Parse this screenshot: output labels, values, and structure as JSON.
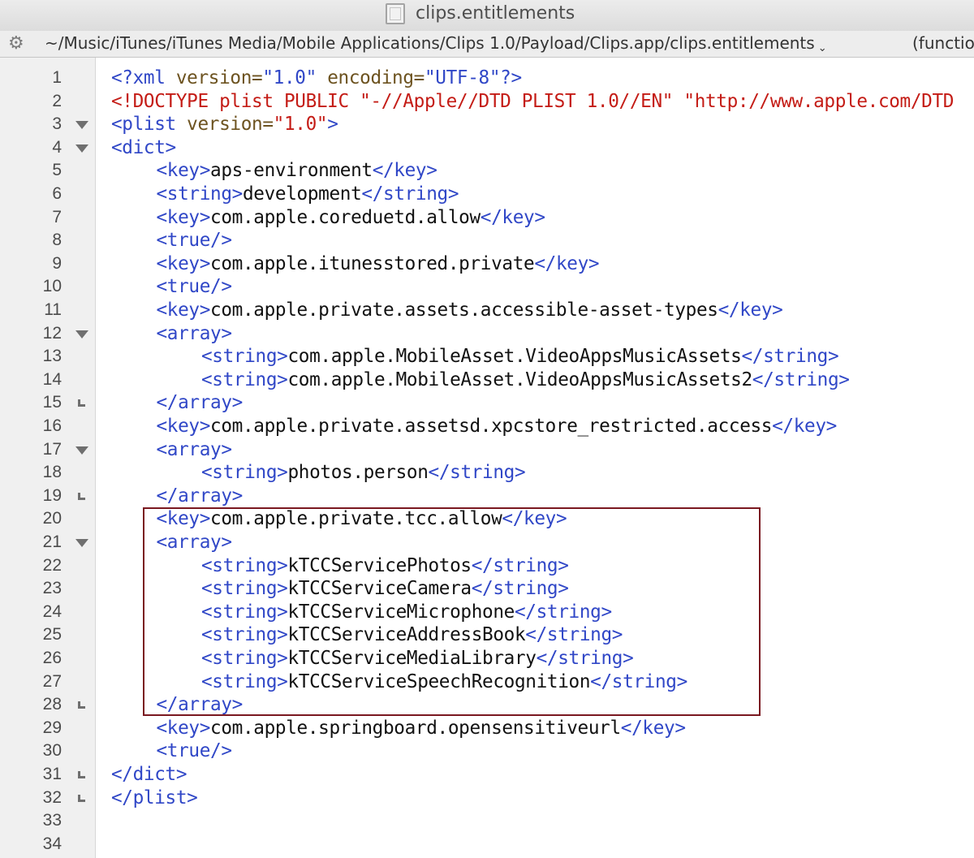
{
  "window": {
    "title": "clips.entitlements",
    "path": "~/Music/iTunes/iTunes Media/Mobile Applications/Clips 1.0/Payload/Clips.app/clips.entitlements",
    "function_menu": "(functio"
  },
  "icons": {
    "document": "document-icon",
    "gear": "gear-icon",
    "chevron": "chevron-down-icon",
    "fold_open": "disclosure-triangle-icon",
    "fold_end": "fold-end-icon"
  },
  "colors": {
    "tag": "#3047c7",
    "text": "#111111",
    "doctype": "#c41c16",
    "attribute": "#6d5320",
    "value": "#c41c16",
    "highlight_box": "#7a1820"
  },
  "highlight_box": {
    "from_line": 20,
    "to_line": 28
  },
  "lines": [
    {
      "n": "1",
      "fold": "",
      "indent": 0,
      "tokens": [
        [
          "tag",
          "<?xml "
        ],
        [
          "attr",
          "version="
        ],
        [
          "tag",
          "\"1.0\" "
        ],
        [
          "attr",
          "encoding="
        ],
        [
          "tag",
          "\"UTF-8\"?>"
        ]
      ]
    },
    {
      "n": "2",
      "fold": "",
      "indent": 0,
      "tokens": [
        [
          "doctype",
          "<!DOCTYPE plist PUBLIC \"-//Apple//DTD PLIST 1.0//EN\" \"http://www.apple.com/DTD"
        ]
      ]
    },
    {
      "n": "3",
      "fold": "open",
      "indent": 0,
      "tokens": [
        [
          "tag",
          "<plist "
        ],
        [
          "attr",
          "version="
        ],
        [
          "value",
          "\"1.0\""
        ],
        [
          "tag",
          ">"
        ]
      ]
    },
    {
      "n": "4",
      "fold": "open",
      "indent": 0,
      "tokens": [
        [
          "tag",
          "<dict>"
        ]
      ]
    },
    {
      "n": "5",
      "fold": "",
      "indent": 1,
      "tokens": [
        [
          "tag",
          "<key>"
        ],
        [
          "text",
          "aps-environment"
        ],
        [
          "tag",
          "</key>"
        ]
      ]
    },
    {
      "n": "6",
      "fold": "",
      "indent": 1,
      "tokens": [
        [
          "tag",
          "<string>"
        ],
        [
          "text",
          "development"
        ],
        [
          "tag",
          "</string>"
        ]
      ]
    },
    {
      "n": "7",
      "fold": "",
      "indent": 1,
      "tokens": [
        [
          "tag",
          "<key>"
        ],
        [
          "text",
          "com.apple.coreduetd.allow"
        ],
        [
          "tag",
          "</key>"
        ]
      ]
    },
    {
      "n": "8",
      "fold": "",
      "indent": 1,
      "tokens": [
        [
          "tag",
          "<true/>"
        ]
      ]
    },
    {
      "n": "9",
      "fold": "",
      "indent": 1,
      "tokens": [
        [
          "tag",
          "<key>"
        ],
        [
          "text",
          "com.apple.itunesstored.private"
        ],
        [
          "tag",
          "</key>"
        ]
      ]
    },
    {
      "n": "10",
      "fold": "",
      "indent": 1,
      "tokens": [
        [
          "tag",
          "<true/>"
        ]
      ]
    },
    {
      "n": "11",
      "fold": "",
      "indent": 1,
      "tokens": [
        [
          "tag",
          "<key>"
        ],
        [
          "text",
          "com.apple.private.assets.accessible-asset-types"
        ],
        [
          "tag",
          "</key>"
        ]
      ]
    },
    {
      "n": "12",
      "fold": "open",
      "indent": 1,
      "tokens": [
        [
          "tag",
          "<array>"
        ]
      ]
    },
    {
      "n": "13",
      "fold": "",
      "indent": 2,
      "tokens": [
        [
          "tag",
          "<string>"
        ],
        [
          "text",
          "com.apple.MobileAsset.VideoAppsMusicAssets"
        ],
        [
          "tag",
          "</string>"
        ]
      ]
    },
    {
      "n": "14",
      "fold": "",
      "indent": 2,
      "tokens": [
        [
          "tag",
          "<string>"
        ],
        [
          "text",
          "com.apple.MobileAsset.VideoAppsMusicAssets2"
        ],
        [
          "tag",
          "</string>"
        ]
      ]
    },
    {
      "n": "15",
      "fold": "end",
      "indent": 1,
      "tokens": [
        [
          "tag",
          "</array>"
        ]
      ]
    },
    {
      "n": "16",
      "fold": "",
      "indent": 1,
      "tokens": [
        [
          "tag",
          "<key>"
        ],
        [
          "text",
          "com.apple.private.assetsd.xpcstore_restricted.access"
        ],
        [
          "tag",
          "</key>"
        ]
      ]
    },
    {
      "n": "17",
      "fold": "open",
      "indent": 1,
      "tokens": [
        [
          "tag",
          "<array>"
        ]
      ]
    },
    {
      "n": "18",
      "fold": "",
      "indent": 2,
      "tokens": [
        [
          "tag",
          "<string>"
        ],
        [
          "text",
          "photos.person"
        ],
        [
          "tag",
          "</string>"
        ]
      ]
    },
    {
      "n": "19",
      "fold": "end",
      "indent": 1,
      "tokens": [
        [
          "tag",
          "</array>"
        ]
      ]
    },
    {
      "n": "20",
      "fold": "",
      "indent": 1,
      "tokens": [
        [
          "tag",
          "<key>"
        ],
        [
          "text",
          "com.apple.private.tcc.allow"
        ],
        [
          "tag",
          "</key>"
        ]
      ]
    },
    {
      "n": "21",
      "fold": "open",
      "indent": 1,
      "tokens": [
        [
          "tag",
          "<array>"
        ]
      ]
    },
    {
      "n": "22",
      "fold": "",
      "indent": 2,
      "tokens": [
        [
          "tag",
          "<string>"
        ],
        [
          "text",
          "kTCCServicePhotos"
        ],
        [
          "tag",
          "</string>"
        ]
      ]
    },
    {
      "n": "23",
      "fold": "",
      "indent": 2,
      "tokens": [
        [
          "tag",
          "<string>"
        ],
        [
          "text",
          "kTCCServiceCamera"
        ],
        [
          "tag",
          "</string>"
        ]
      ]
    },
    {
      "n": "24",
      "fold": "",
      "indent": 2,
      "tokens": [
        [
          "tag",
          "<string>"
        ],
        [
          "text",
          "kTCCServiceMicrophone"
        ],
        [
          "tag",
          "</string>"
        ]
      ]
    },
    {
      "n": "25",
      "fold": "",
      "indent": 2,
      "tokens": [
        [
          "tag",
          "<string>"
        ],
        [
          "text",
          "kTCCServiceAddressBook"
        ],
        [
          "tag",
          "</string>"
        ]
      ]
    },
    {
      "n": "26",
      "fold": "",
      "indent": 2,
      "tokens": [
        [
          "tag",
          "<string>"
        ],
        [
          "text",
          "kTCCServiceMediaLibrary"
        ],
        [
          "tag",
          "</string>"
        ]
      ]
    },
    {
      "n": "27",
      "fold": "",
      "indent": 2,
      "tokens": [
        [
          "tag",
          "<string>"
        ],
        [
          "text",
          "kTCCServiceSpeechRecognition"
        ],
        [
          "tag",
          "</string>"
        ]
      ]
    },
    {
      "n": "28",
      "fold": "end",
      "indent": 1,
      "tokens": [
        [
          "tag",
          "</array>"
        ]
      ]
    },
    {
      "n": "29",
      "fold": "",
      "indent": 1,
      "tokens": [
        [
          "tag",
          "<key>"
        ],
        [
          "text",
          "com.apple.springboard.opensensitiveurl"
        ],
        [
          "tag",
          "</key>"
        ]
      ]
    },
    {
      "n": "30",
      "fold": "",
      "indent": 1,
      "tokens": [
        [
          "tag",
          "<true/>"
        ]
      ]
    },
    {
      "n": "31",
      "fold": "end",
      "indent": 0,
      "tokens": [
        [
          "tag",
          "</dict>"
        ]
      ]
    },
    {
      "n": "32",
      "fold": "end",
      "indent": 0,
      "tokens": [
        [
          "tag",
          "</plist>"
        ]
      ]
    },
    {
      "n": "33",
      "fold": "",
      "indent": 0,
      "tokens": []
    },
    {
      "n": "34",
      "fold": "",
      "indent": 0,
      "tokens": []
    }
  ]
}
